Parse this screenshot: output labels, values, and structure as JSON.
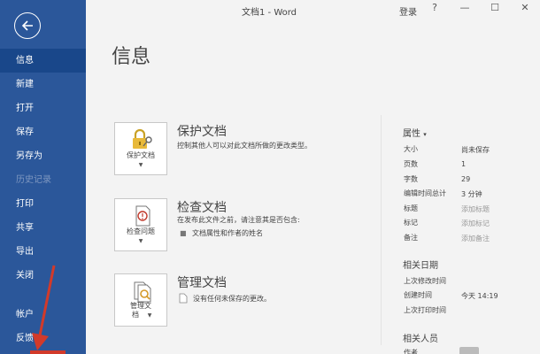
{
  "window": {
    "title": "文档1 - Word",
    "login": "登录",
    "help": "?",
    "minimize": "—",
    "maximize": "☐",
    "close": "✕"
  },
  "sidebar": {
    "items": [
      {
        "label": "信息"
      },
      {
        "label": "新建"
      },
      {
        "label": "打开"
      },
      {
        "label": "保存"
      },
      {
        "label": "另存为"
      },
      {
        "label": "历史记录"
      },
      {
        "label": "打印"
      },
      {
        "label": "共享"
      },
      {
        "label": "导出"
      },
      {
        "label": "关闭"
      },
      {
        "label": "帐户"
      },
      {
        "label": "反馈"
      }
    ]
  },
  "main": {
    "title": "信息",
    "sections": [
      {
        "card_label": "保护文档",
        "title": "保护文档",
        "desc": "控制其他人可以对此文档所做的更改类型。"
      },
      {
        "card_label": "检查问题",
        "title": "检查文档",
        "desc": "在发布此文件之前，请注意其是否包含:",
        "bullets": [
          "文档属性和作者的姓名"
        ]
      },
      {
        "card_label1": "管理文",
        "card_label2": "档",
        "title": "管理文档",
        "desc": "没有任何未保存的更改。"
      }
    ]
  },
  "properties": {
    "header": "属性",
    "header_caret": "▾",
    "rows": [
      {
        "label": "大小",
        "value": "尚未保存"
      },
      {
        "label": "页数",
        "value": "1"
      },
      {
        "label": "字数",
        "value": "29"
      },
      {
        "label": "编辑时间总计",
        "value": "3 分钟"
      },
      {
        "label": "标题",
        "value": "添加标题"
      },
      {
        "label": "标记",
        "value": "添加标记"
      },
      {
        "label": "备注",
        "value": "添加备注"
      }
    ],
    "dates_header": "相关日期",
    "dates": [
      {
        "label": "上次修改时间",
        "value": ""
      },
      {
        "label": "创建时间",
        "value": "今天 14:19"
      },
      {
        "label": "上次打印时间",
        "value": ""
      }
    ],
    "people_header": "相关人员",
    "people": [
      {
        "label": "作者"
      }
    ]
  }
}
